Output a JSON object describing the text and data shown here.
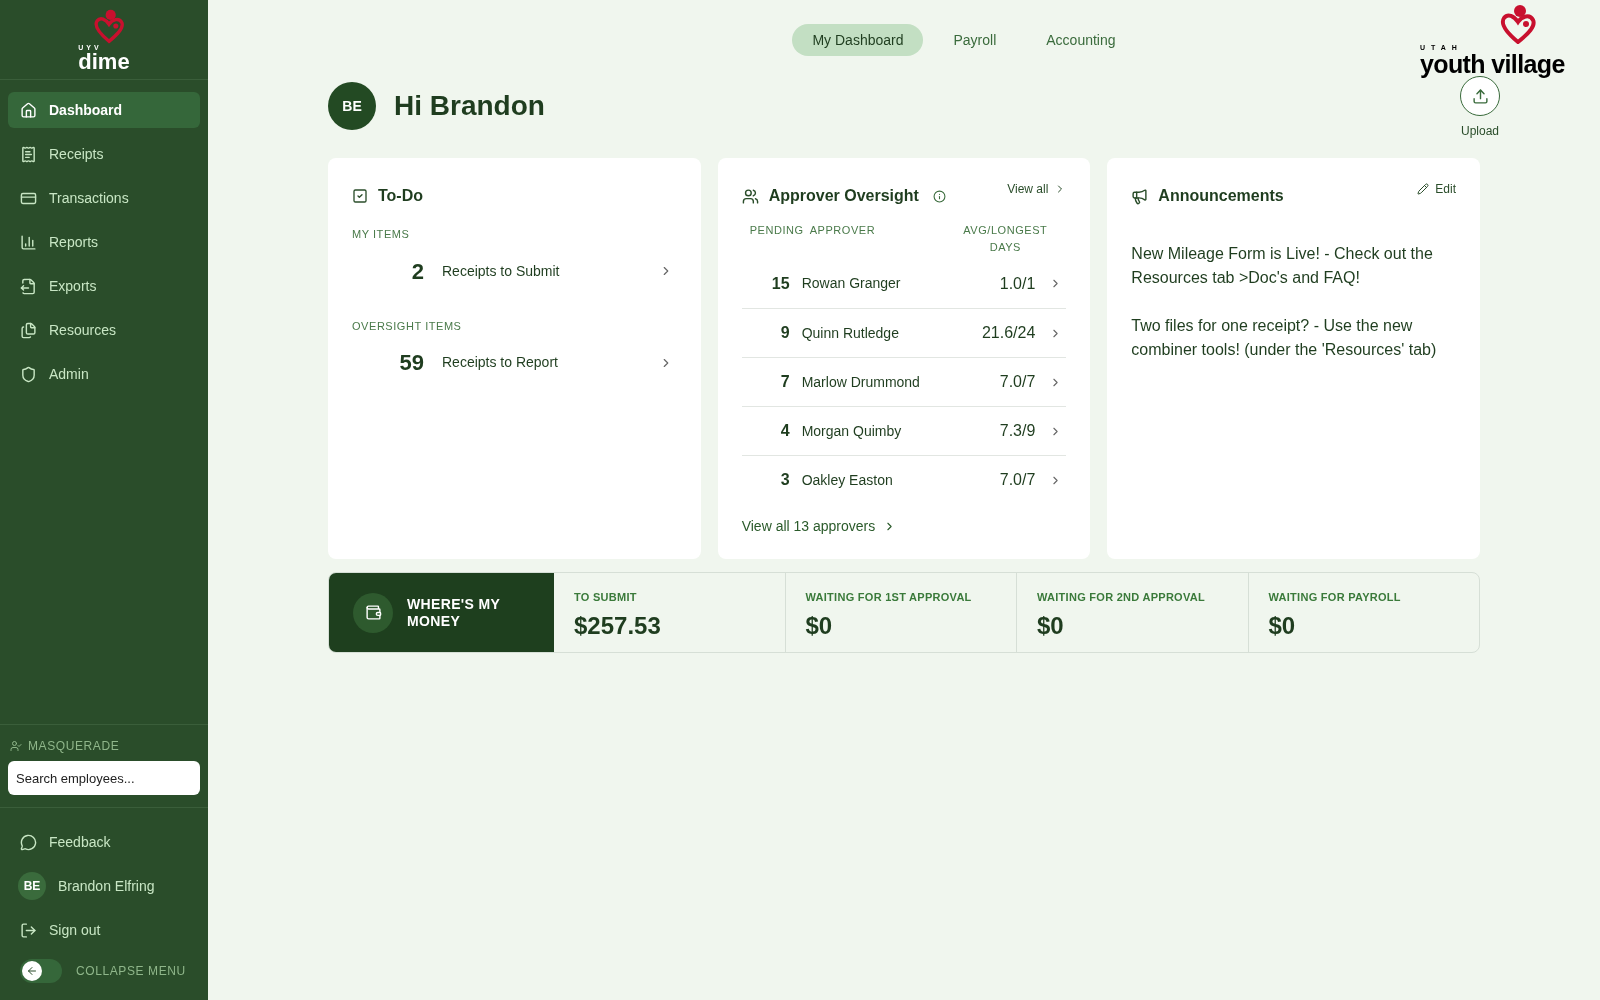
{
  "sidebar": {
    "logo": {
      "small": "UYV",
      "word": "dime"
    },
    "items": [
      {
        "label": "Dashboard",
        "selected": true
      },
      {
        "label": "Receipts",
        "selected": false
      },
      {
        "label": "Transactions",
        "selected": false
      },
      {
        "label": "Reports",
        "selected": false
      },
      {
        "label": "Exports",
        "selected": false
      },
      {
        "label": "Resources",
        "selected": false
      },
      {
        "label": "Admin",
        "selected": false
      }
    ],
    "masquerade": {
      "label": "MASQUERADE",
      "placeholder": "Search employees..."
    },
    "footer": [
      {
        "kind": "link",
        "label": "Feedback"
      },
      {
        "kind": "user",
        "initials": "BE",
        "label": "Brandon Elfring"
      },
      {
        "kind": "link",
        "label": "Sign out"
      }
    ],
    "collapse": {
      "label": "COLLAPSE MENU",
      "on": false
    }
  },
  "tabs": [
    {
      "label": "My Dashboard",
      "selected": true
    },
    {
      "label": "Payroll",
      "selected": false
    },
    {
      "label": "Accounting",
      "selected": false
    }
  ],
  "brand": {
    "small": "UTAH",
    "word": "youth village"
  },
  "greeting": {
    "initials": "BE",
    "text": "Hi Brandon"
  },
  "upload": "Upload",
  "todo": {
    "title": "To-Do",
    "sections": [
      {
        "heading": "MY ITEMS",
        "items": [
          {
            "count": "2",
            "label": "Receipts to Submit"
          }
        ]
      },
      {
        "heading": "OVERSIGHT ITEMS",
        "items": [
          {
            "count": "59",
            "label": "Receipts to Report"
          }
        ]
      }
    ]
  },
  "approver_oversight": {
    "title": "Approver Oversight",
    "view_all": "View all",
    "columns": [
      "PENDING",
      "APPROVER",
      "AVG/LONGEST DAYS"
    ],
    "rows": [
      {
        "pending": "15",
        "approver": "Rowan Granger",
        "days": "1.0/1"
      },
      {
        "pending": "9",
        "approver": "Quinn Rutledge",
        "days": "21.6/24"
      },
      {
        "pending": "7",
        "approver": "Marlow Drummond",
        "days": "7.0/7"
      },
      {
        "pending": "4",
        "approver": "Morgan Quimby",
        "days": "7.3/9"
      },
      {
        "pending": "3",
        "approver": "Oakley Easton",
        "days": "7.0/7"
      }
    ],
    "footer_link": "View all 13 approvers"
  },
  "announcements": {
    "title": "Announcements",
    "edit": "Edit",
    "paragraphs": [
      "New Mileage Form is Live! - Check out the Resources tab >Doc's and FAQ!",
      "Two files for one receipt? - Use the new combiner tools! (under the 'Resources' tab)"
    ]
  },
  "money": {
    "title": "WHERE'S MY MONEY",
    "stats": [
      {
        "label": "TO SUBMIT",
        "value": "$257.53"
      },
      {
        "label": "WAITING FOR 1ST APPROVAL",
        "value": "$0"
      },
      {
        "label": "WAITING FOR 2ND APPROVAL",
        "value": "$0"
      },
      {
        "label": "WAITING FOR PAYROLL",
        "value": "$0"
      }
    ]
  }
}
